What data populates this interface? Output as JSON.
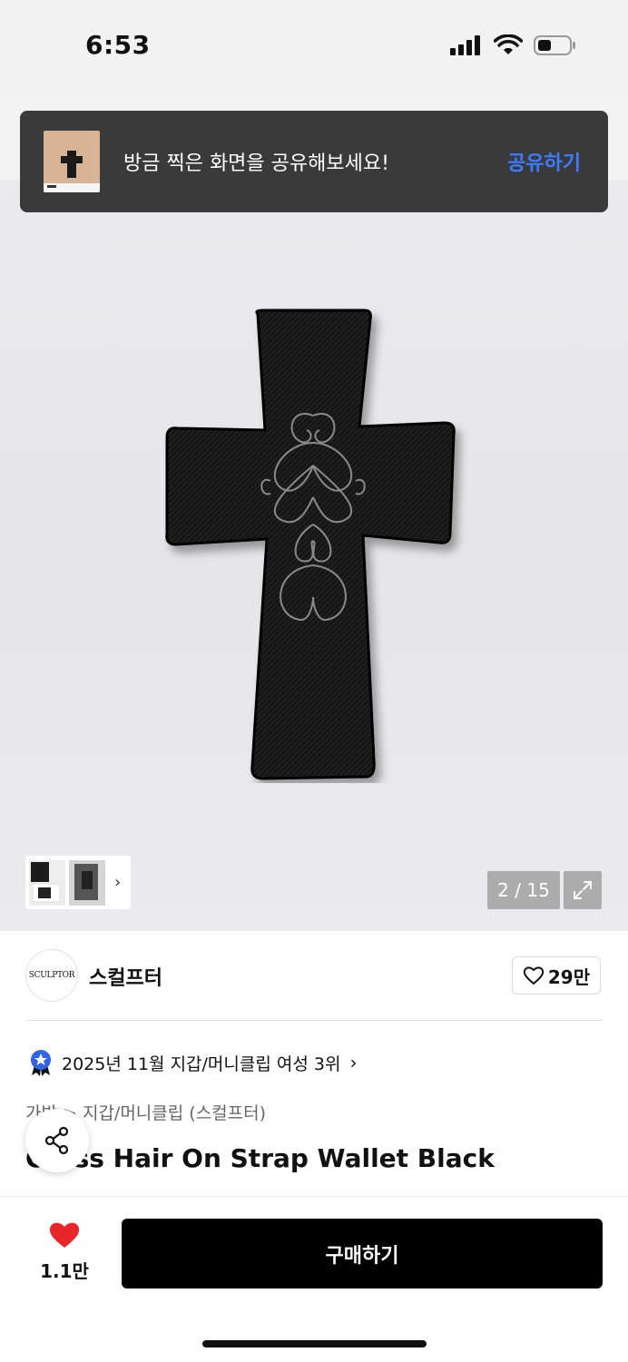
{
  "status_bar": {
    "time": "6:53"
  },
  "share_toast": {
    "message": "방금 찍은 화면을 공유해보세요!",
    "action": "공유하기"
  },
  "gallery": {
    "counter": "2 / 15"
  },
  "brand": {
    "logo_text": "SCULPTOR",
    "name": "스컬프터",
    "likes": "29만"
  },
  "ranking": {
    "text": "2025년 11월 지갑/머니클립 여성 3위"
  },
  "product": {
    "category": "가방 > 지갑/머니클립 (스컬프터)",
    "title": "Cross Hair On Strap Wallet Black"
  },
  "bottom": {
    "fav_count": "1.1만",
    "buy_label": "구매하기"
  },
  "colors": {
    "accent": "#3d7cff",
    "heart": "#e8262a",
    "badge": "#2f63e8"
  }
}
